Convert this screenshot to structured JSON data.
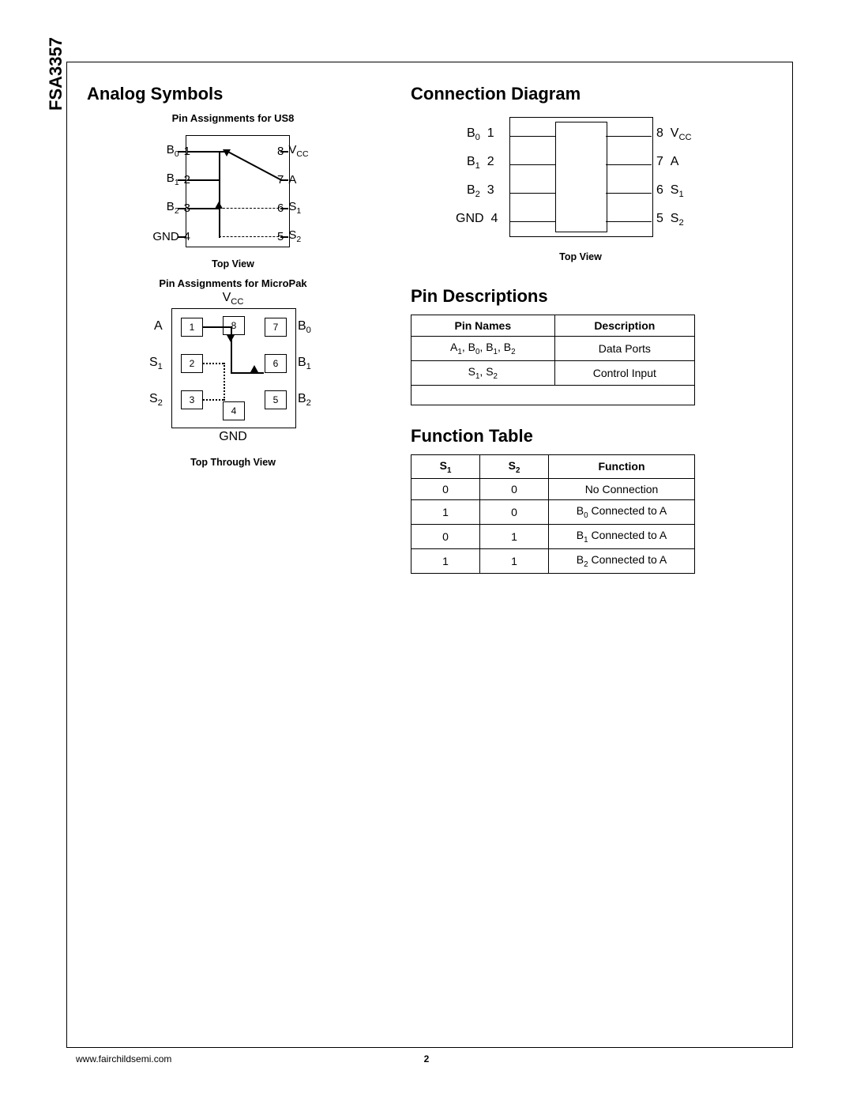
{
  "part_number": "FSA3357",
  "left": {
    "heading": "Analog Symbols",
    "us8_caption": "Pin Assignments for US8",
    "us8_view": "Top View",
    "micropak_caption": "Pin Assignments for MicroPak",
    "micropak_view": "Top Through View",
    "us8_pins_left": [
      {
        "label_html": "B<sub>0</sub>",
        "num": "1"
      },
      {
        "label_html": "B<sub>1</sub>",
        "num": "2"
      },
      {
        "label_html": "B<sub>2</sub>",
        "num": "3"
      },
      {
        "label_html": "GND",
        "num": "4"
      }
    ],
    "us8_pins_right": [
      {
        "num": "8",
        "label_html": "V<sub>CC</sub>"
      },
      {
        "num": "7",
        "label_html": "A"
      },
      {
        "num": "6",
        "label_html": "S<sub>1</sub>"
      },
      {
        "num": "5",
        "label_html": "S<sub>2</sub>"
      }
    ],
    "micropak": {
      "vcc": "V<sub>CC</sub>",
      "gnd": "GND",
      "left_labels": [
        "A",
        "S<sub>1</sub>",
        "S<sub>2</sub>"
      ],
      "right_labels": [
        "B<sub>0</sub>",
        "B<sub>1</sub>",
        "B<sub>2</sub>"
      ],
      "pads": [
        "1",
        "2",
        "3",
        "4",
        "5",
        "6",
        "7",
        "8"
      ]
    }
  },
  "right": {
    "conn_heading": "Connection Diagram",
    "conn_view": "Top View",
    "conn_left": [
      {
        "label_html": "B<sub>0</sub>",
        "num": "1"
      },
      {
        "label_html": "B<sub>1</sub>",
        "num": "2"
      },
      {
        "label_html": "B<sub>2</sub>",
        "num": "3"
      },
      {
        "label_html": "GND",
        "num": "4"
      }
    ],
    "conn_right": [
      {
        "num": "8",
        "label_html": "V<sub>CC</sub>"
      },
      {
        "num": "7",
        "label_html": "A"
      },
      {
        "num": "6",
        "label_html": "S<sub>1</sub>"
      },
      {
        "num": "5",
        "label_html": "S<sub>2</sub>"
      }
    ],
    "pindesc_heading": "Pin Descriptions",
    "pin_table": {
      "headers": [
        "Pin Names",
        "Description"
      ],
      "rows": [
        [
          "A<sub>1</sub>, B<sub>0</sub>, B<sub>1</sub>, B<sub>2</sub>",
          "Data Ports"
        ],
        [
          "S<sub>1</sub>, S<sub>2</sub>",
          "Control Input"
        ]
      ]
    },
    "func_heading": "Function Table",
    "func_table": {
      "headers": [
        "S<sub>1</sub>",
        "S<sub>2</sub>",
        "Function"
      ],
      "rows": [
        [
          "0",
          "0",
          "No Connection"
        ],
        [
          "1",
          "0",
          "B<sub>0</sub> Connected to A"
        ],
        [
          "0",
          "1",
          "B<sub>1</sub> Connected to A"
        ],
        [
          "1",
          "1",
          "B<sub>2</sub> Connected to A"
        ]
      ]
    }
  },
  "footer": {
    "url": "www.fairchildsemi.com",
    "page": "2"
  }
}
